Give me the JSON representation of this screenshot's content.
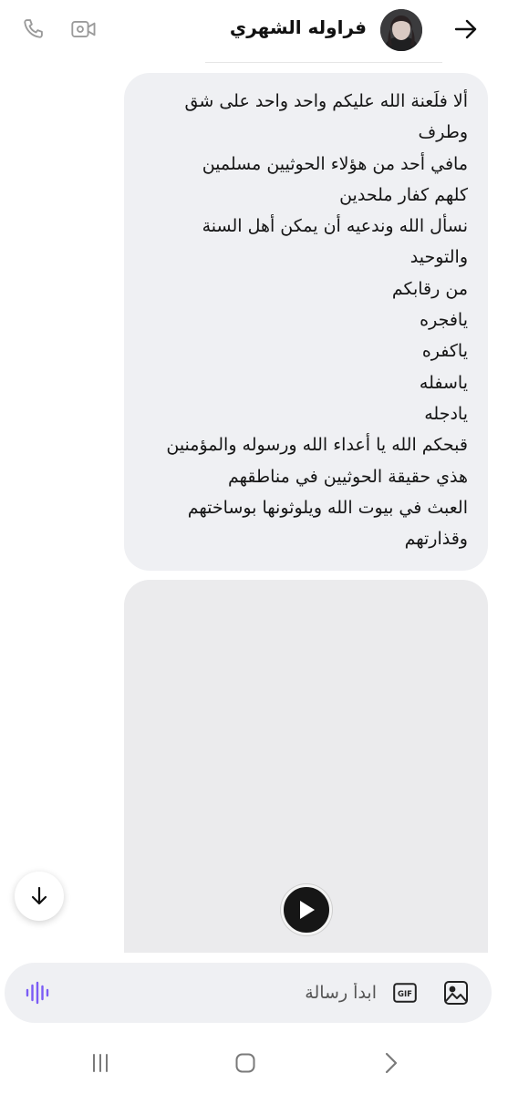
{
  "header": {
    "contact_name": "فراوله الشهري",
    "icons": [
      "phone-icon",
      "video-call-icon",
      "back-arrow-icon",
      "avatar"
    ]
  },
  "message": {
    "lines": [
      "ألا فلَعنة الله عليكم واحد واحد على شق",
      "وطرف",
      "مافي أحد من هؤلاء الحوثيين  مسلمين",
      "كلهم كفار ملحدين",
      "نسأل الله وندعيه أن يمكن أهل السنة",
      "والتوحيد",
      "من رقابكم",
      "يافجره",
      "ياكفره",
      "ياسفله",
      "يادجله",
      "قبحكم الله يا أعداء الله ورسوله والمؤمنين",
      "هذي حقيقة الحوثيين في مناطقهم",
      "العبث في بيوت الله ويلوثونها بوساختهم",
      "وقذارتهم"
    ]
  },
  "media": {
    "icon": "play-icon"
  },
  "composer": {
    "placeholder": "ابدأ رسالة",
    "gif_label": "GIF",
    "icons": [
      "voice-message-icon",
      "gif-icon",
      "gallery-icon"
    ]
  },
  "navbar": {
    "icons": [
      "recents-icon",
      "home-icon",
      "back-icon"
    ]
  },
  "colors": {
    "bubble_bg": "#eff0f3",
    "composer_bg": "#eff0f3",
    "voice_accent": "#7b5cf5",
    "play_bg": "#161616"
  }
}
